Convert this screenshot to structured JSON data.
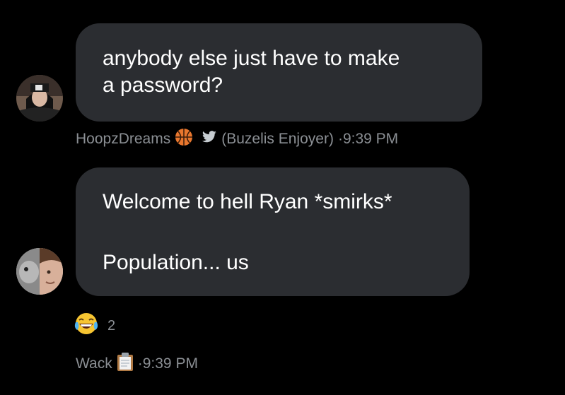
{
  "messages": [
    {
      "text_lines": [
        "anybody else just have to make",
        "a password?"
      ],
      "author": "HoopzDreams",
      "author_suffix": "(Buzelis Enjoyer)",
      "separator": "·",
      "time": "9:39 PM"
    },
    {
      "text_lines": [
        "Welcome to hell Ryan *smirks*",
        "",
        "Population... us"
      ],
      "reaction_count": "2"
    }
  ],
  "footer": {
    "author": "Wack",
    "separator": "·",
    "time": "9:39 PM"
  },
  "icons": {
    "basketball": "basketball-emoji",
    "bird": "twitter-bird",
    "laughing": "face-with-tears-of-joy",
    "clipboard": "clipboard-emoji"
  },
  "colors": {
    "background": "#000000",
    "bubble": "#2b2d31",
    "text": "#ffffff",
    "meta": "#8b8f94",
    "bird": "#c6ccd1"
  }
}
